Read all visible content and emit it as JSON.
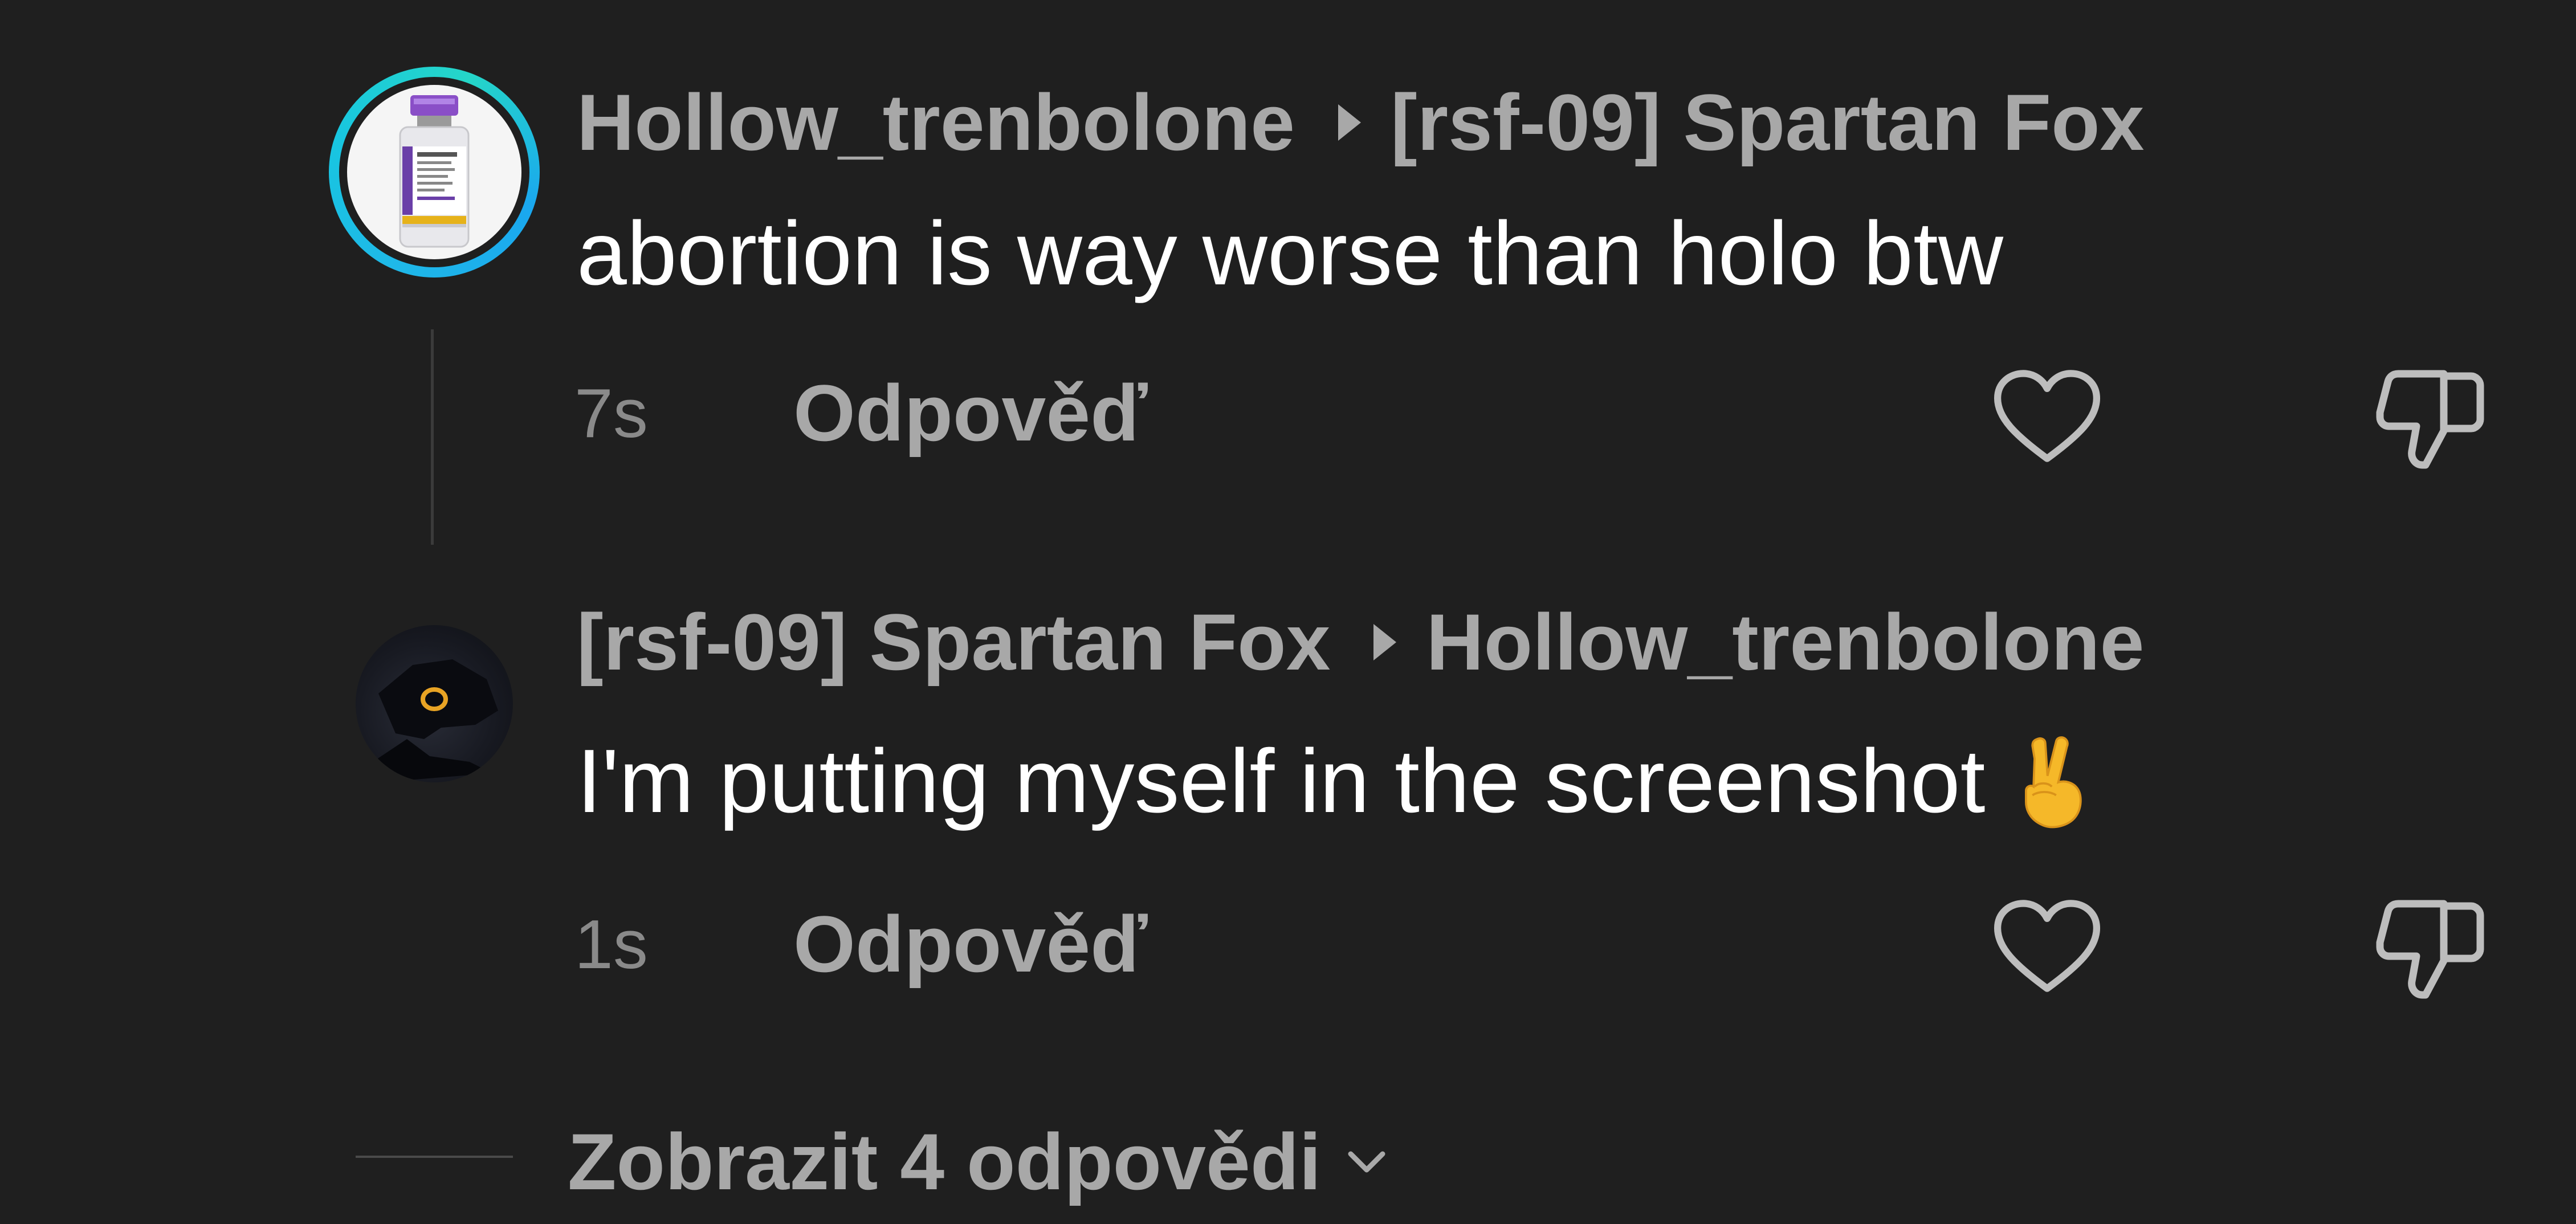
{
  "thread": {
    "comments": [
      {
        "author": "Hollow_trenbolone",
        "reply_to": "[rsf-09] Spartan Fox",
        "text": "abortion is way worse than holo btw",
        "time": "7s",
        "reply_label": "Odpověď",
        "avatar_icon": "vial-avatar",
        "has_story_ring": true
      },
      {
        "author": "[rsf-09] Spartan Fox",
        "reply_to": "Hollow_trenbolone",
        "text": "I'm putting myself in the screenshot",
        "emoji": "✌️",
        "time": "1s",
        "reply_label": "Odpověď",
        "avatar_icon": "dark-character-avatar",
        "has_story_ring": false
      }
    ],
    "view_replies_label": "Zobrazit 4 odpovědi"
  },
  "colors": {
    "background": "#1f1f1f",
    "username": "#a8a8a8",
    "body_text": "#ffffff",
    "timestamp": "#8a8a8a",
    "story_ring": "#1fb8e8"
  },
  "icons": [
    "vial-avatar",
    "dark-character-avatar",
    "caret-right-icon",
    "heart-icon",
    "thumbs-down-icon",
    "chevron-down-icon",
    "victory-hand-emoji"
  ]
}
